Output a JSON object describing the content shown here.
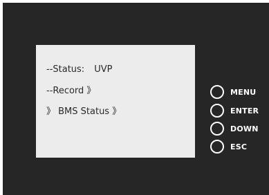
{
  "screen": {
    "status_label": "--Status:",
    "status_value": "UVP",
    "record_line": "--Record 》",
    "bms_line": "》 BMS Status 》"
  },
  "keys": [
    {
      "label": "MENU",
      "icon": "circle-button-icon"
    },
    {
      "label": "ENTER",
      "icon": "circle-button-icon"
    },
    {
      "label": "DOWN",
      "icon": "circle-button-icon"
    },
    {
      "label": "ESC",
      "icon": "circle-button-icon"
    }
  ],
  "colors": {
    "panel": "#262626",
    "screen": "#ececec",
    "screen_text": "#2a2a2a",
    "key_text": "#ffffff"
  }
}
